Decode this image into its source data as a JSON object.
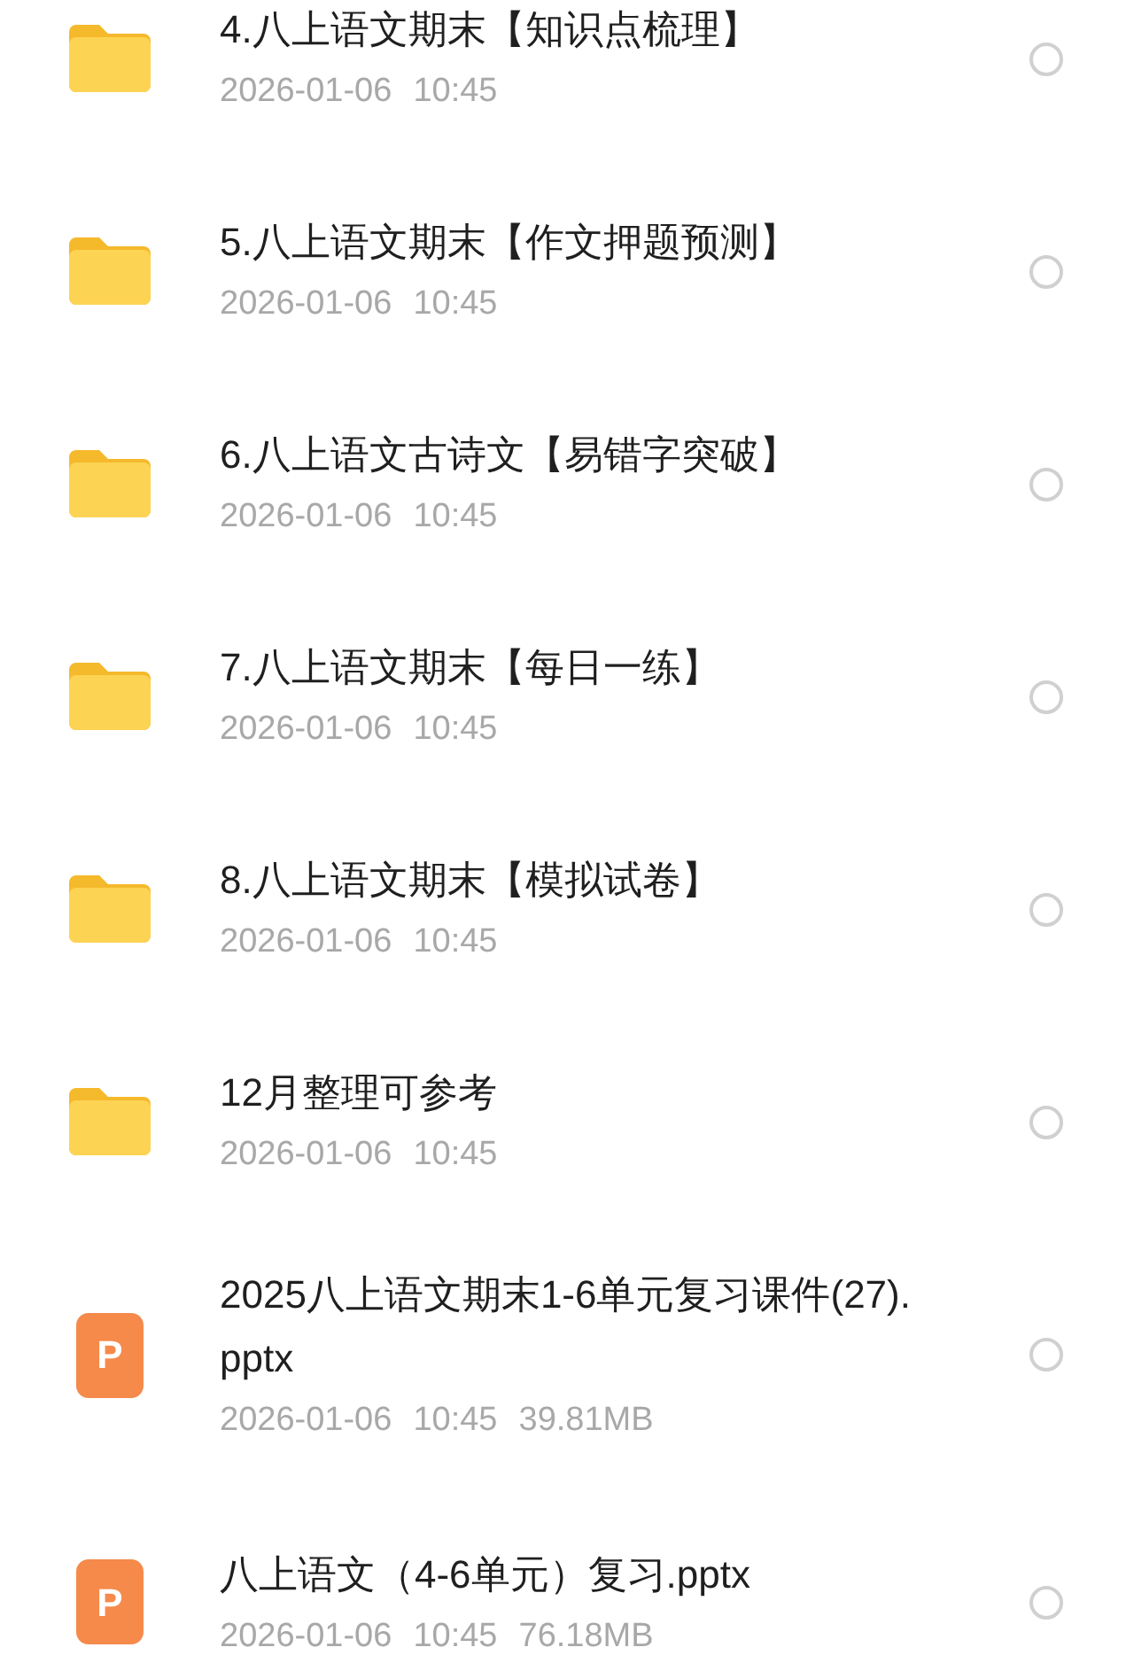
{
  "items": [
    {
      "kind": "folder",
      "name": "4.八上语文期末【知识点梳理】",
      "date": "2026-01-06",
      "time": "10:45",
      "selected": false
    },
    {
      "kind": "folder",
      "name": "5.八上语文期末【作文押题预测】",
      "date": "2026-01-06",
      "time": "10:45",
      "selected": false
    },
    {
      "kind": "folder",
      "name": "6.八上语文古诗文【易错字突破】",
      "date": "2026-01-06",
      "time": "10:45",
      "selected": false
    },
    {
      "kind": "folder",
      "name": "7.八上语文期末【每日一练】",
      "date": "2026-01-06",
      "time": "10:45",
      "selected": false
    },
    {
      "kind": "folder",
      "name": "8.八上语文期末【模拟试卷】",
      "date": "2026-01-06",
      "time": "10:45",
      "selected": false
    },
    {
      "kind": "folder",
      "name": "12月整理可参考",
      "date": "2026-01-06",
      "time": "10:45",
      "selected": false
    },
    {
      "kind": "pptx",
      "badge": "P",
      "name": "2025八上语文期末1-6单元复习课件(27).pptx",
      "date": "2026-01-06",
      "time": "10:45",
      "size": "39.81MB",
      "selected": false
    },
    {
      "kind": "pptx",
      "badge": "P",
      "name": "八上语文（4-6单元）复习.pptx",
      "date": "2026-01-06",
      "time": "10:45",
      "size": "76.18MB",
      "selected": false
    }
  ]
}
